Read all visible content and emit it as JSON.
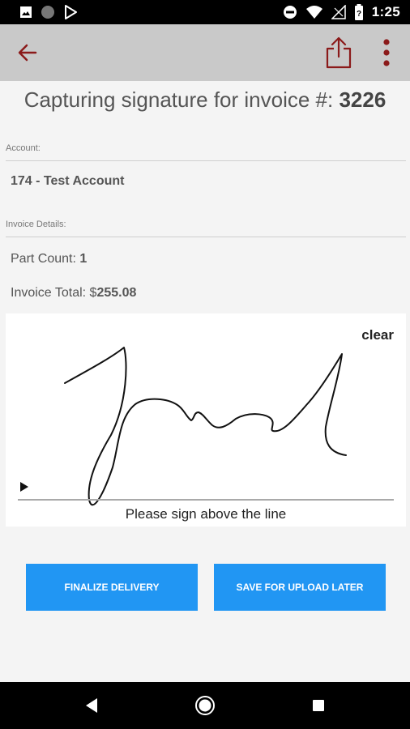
{
  "status_bar": {
    "time": "1:25",
    "left_icons": [
      "image-icon",
      "circle-icon",
      "play-store-icon"
    ],
    "right_icons": [
      "do-not-disturb-icon",
      "wifi-icon",
      "signal-icon",
      "battery-icon"
    ]
  },
  "app_bar": {
    "back_icon": "arrow-back-icon",
    "share_icon": "share-icon",
    "more_icon": "more-vert-icon",
    "icon_color": "#8b1a1a"
  },
  "title": {
    "prefix": "Capturing signature for invoice #: ",
    "invoice_number": "3226"
  },
  "account": {
    "label": "Account:",
    "value": "174 - Test Account"
  },
  "invoice_details": {
    "label": "Invoice Details:",
    "part_count_label": "Part Count: ",
    "part_count_value": "1",
    "total_label": "Invoice Total: $",
    "total_value": "255.08"
  },
  "signature_pad": {
    "clear_label": "clear",
    "caption": "Please sign above the line"
  },
  "buttons": {
    "finalize_label": "Finalize Delivery",
    "save_label": "Save for Upload Later",
    "color": "#2196f3"
  },
  "nav_bar": {
    "icons": [
      "nav-back-icon",
      "nav-home-icon",
      "nav-recents-icon"
    ]
  }
}
